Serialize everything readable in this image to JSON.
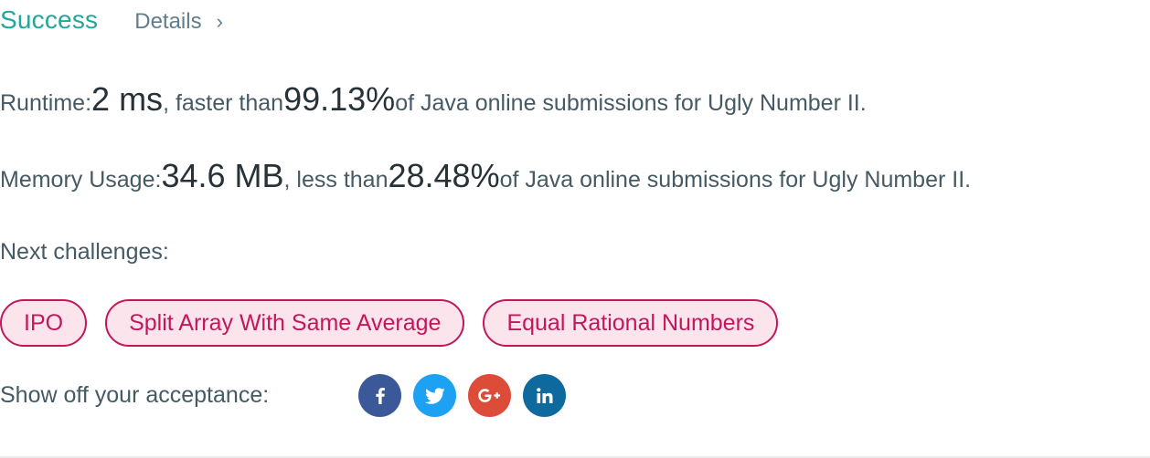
{
  "header": {
    "status": "Success",
    "details_label": "Details",
    "details_chevron": "›"
  },
  "runtime": {
    "label": "Runtime: ",
    "value": "2 ms",
    "comparison": ", faster than ",
    "percent": "99.13%",
    "suffix": " of Java online submissions for Ugly Number II."
  },
  "memory": {
    "label": "Memory Usage: ",
    "value": "34.6 MB",
    "comparison": ", less than ",
    "percent": "28.48%",
    "suffix": " of Java online submissions for Ugly Number II."
  },
  "next": {
    "label": "Next challenges:",
    "challenges": [
      "IPO",
      "Split Array With Same Average",
      "Equal Rational Numbers"
    ]
  },
  "share": {
    "label": "Show off your acceptance:",
    "buttons": [
      {
        "icon": "facebook-icon",
        "color": "#3b5998"
      },
      {
        "icon": "twitter-icon",
        "color": "#1da1f2"
      },
      {
        "icon": "google-plus-icon",
        "color": "#dd4b39"
      },
      {
        "icon": "linkedin-icon",
        "color": "#0e6a9e"
      }
    ]
  },
  "colors": {
    "success": "#26a69a",
    "chip_border": "#c2185b",
    "chip_bg": "#fce4ec"
  }
}
